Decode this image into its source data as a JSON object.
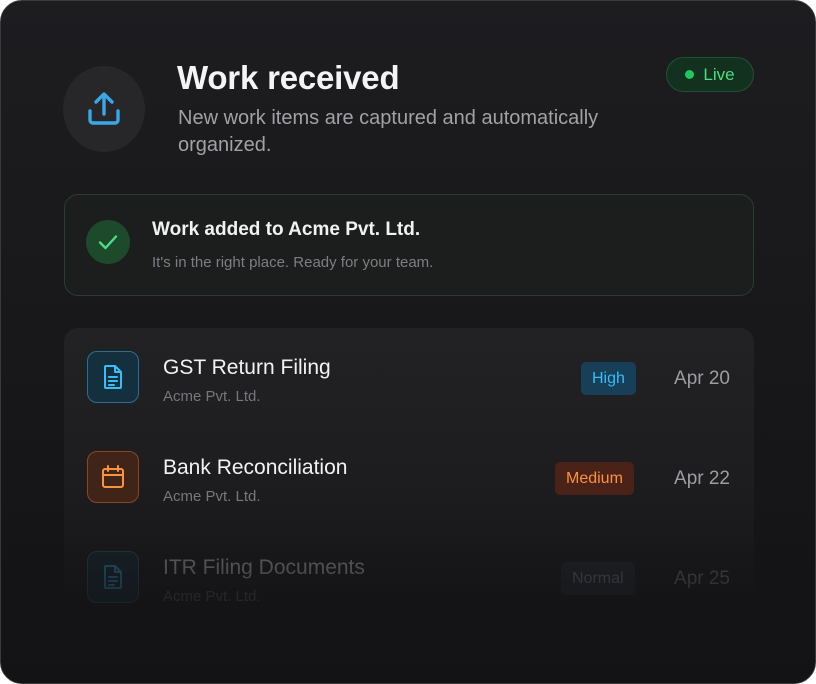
{
  "header": {
    "title": "Work received",
    "subtitle": "New work items are captured and automatically organized.",
    "icon": "upload-icon",
    "status": {
      "label": "Live",
      "color": "#22c55e"
    }
  },
  "notice": {
    "icon": "check-icon",
    "title": "Work added to Acme Pvt. Ltd.",
    "subtitle": "It's in the right place. Ready for your team."
  },
  "work_items": [
    {
      "title": "GST Return Filing",
      "client": "Acme Pvt. Ltd.",
      "priority": "High",
      "priority_color": "#38bdf8",
      "date": "Apr 20",
      "icon": "document-icon",
      "icon_color": "#38bdf8"
    },
    {
      "title": "Bank Reconciliation",
      "client": "Acme Pvt. Ltd.",
      "priority": "Medium",
      "priority_color": "#fb923c",
      "date": "Apr 22",
      "icon": "calendar-icon",
      "icon_color": "#fb923c"
    },
    {
      "title": "ITR Filing Documents",
      "client": "Acme Pvt. Ltd.",
      "priority": "Normal",
      "priority_color": "#94a3b8",
      "date": "Apr 25",
      "icon": "document-icon",
      "icon_color": "#38bdf8"
    }
  ]
}
